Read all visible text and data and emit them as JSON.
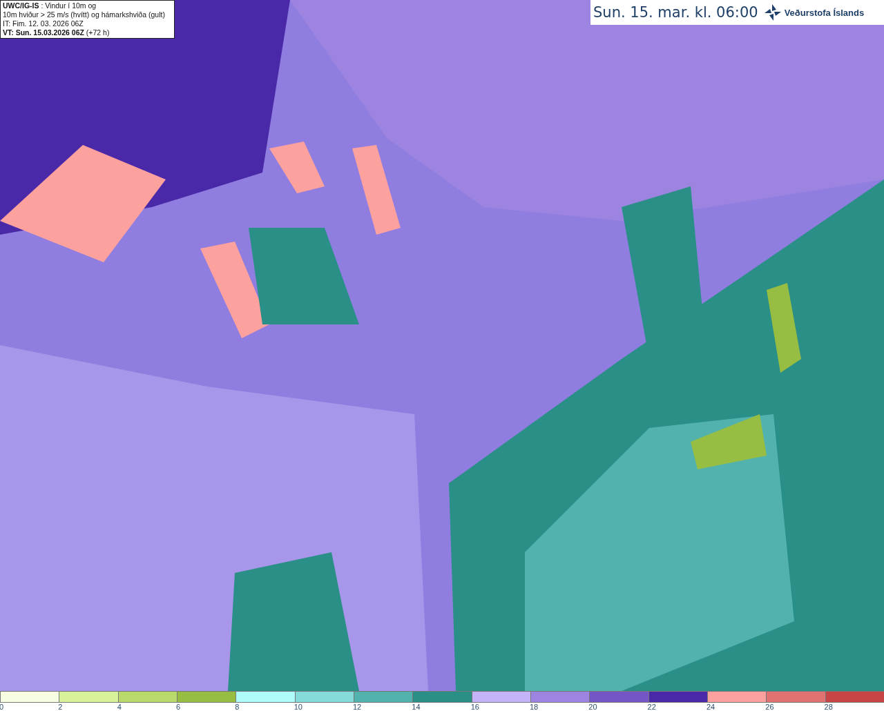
{
  "info_box": {
    "model": "UWC/IG-IS",
    "description": ": Vindur í 10m og",
    "line_2": "10m hviður > 25 m/s (hvítt) og hámarkshviða (gult)",
    "issue_time": "IT: Fim. 12. 03. 2026 06Z",
    "valid_time": "VT: Sun. 15.03.2026 06Z",
    "lead_time": "(+72 h)"
  },
  "header": {
    "title": "Sun. 15. mar. kl. 06:00",
    "logo_text": "Veðurstofa Íslands"
  },
  "legend": [
    {
      "label": "0",
      "color": "#f7fde0"
    },
    {
      "label": "2",
      "color": "#d8f29a"
    },
    {
      "label": "4",
      "color": "#b9d96a"
    },
    {
      "label": "6",
      "color": "#98bd43"
    },
    {
      "label": "8",
      "color": "#aefcfc"
    },
    {
      "label": "10",
      "color": "#84dbd9"
    },
    {
      "label": "12",
      "color": "#52b3ae"
    },
    {
      "label": "14",
      "color": "#2a8f86"
    },
    {
      "label": "16",
      "color": "#c5b3f8"
    },
    {
      "label": "18",
      "color": "#9d84e0"
    },
    {
      "label": "20",
      "color": "#7456c6"
    },
    {
      "label": "22",
      "color": "#4a29a8"
    },
    {
      "label": "24",
      "color": "#fca19e"
    },
    {
      "label": "26",
      "color": "#e07272"
    },
    {
      "label": "28",
      "color": "#c74545"
    }
  ]
}
